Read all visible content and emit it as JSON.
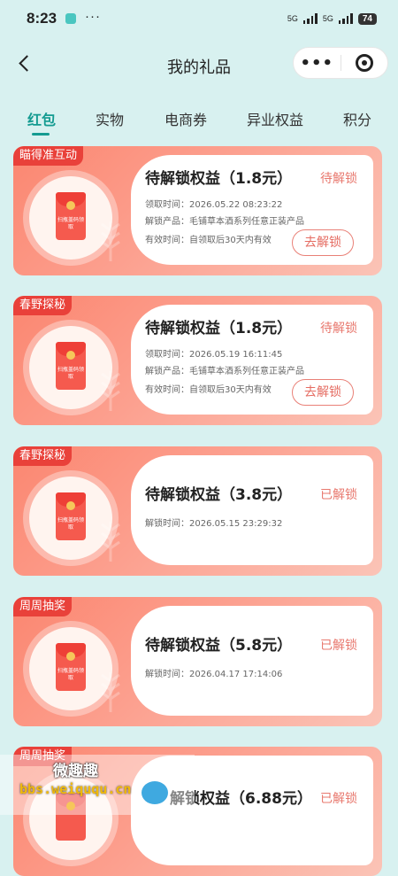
{
  "status_bar": {
    "time": "8:23",
    "net1": "5G",
    "net2": "5G",
    "battery": "74"
  },
  "nav": {
    "title": "我的礼品",
    "more_glyph": "•••"
  },
  "tabs": [
    "红包",
    "实物",
    "电商券",
    "异业权益",
    "积分"
  ],
  "colors": {
    "accent": "#149b91",
    "tag": "#e9413a",
    "status": "#e8786e"
  },
  "cards": [
    {
      "tag": "瞄得准互动",
      "title": "待解锁权益（1.8元）",
      "status": "待解锁",
      "lines": [
        "领取时间：2026.05.22 08:23:22",
        "解锁产品：毛铺草本酒系列任意正装产品",
        "有效时间：自领取后30天内有效"
      ],
      "button": "去解锁",
      "envelope_text": "扫瓶盖码领取"
    },
    {
      "tag": "春野探秘",
      "title": "待解锁权益（1.8元）",
      "status": "待解锁",
      "lines": [
        "领取时间：2026.05.19 16:11:45",
        "解锁产品：毛铺草本酒系列任意正装产品",
        "有效时间：自领取后30天内有效"
      ],
      "button": "去解锁",
      "envelope_text": "扫瓶盖码领取"
    },
    {
      "tag": "春野探秘",
      "title": "待解锁权益（3.8元）",
      "status": "已解锁",
      "lines": [
        "解锁时间：2026.05.15 23:29:32"
      ],
      "envelope_text": "扫瓶盖码领取"
    },
    {
      "tag": "周周抽奖",
      "title": "待解锁权益（5.8元）",
      "status": "已解锁",
      "lines": [
        "解锁时间：2026.04.17 17:14:06"
      ],
      "envelope_text": "扫瓶盖码领取"
    },
    {
      "tag": "周周抽奖",
      "title": "解锁权益（6.88元）",
      "status": "已解锁",
      "lines": [],
      "envelope_text": ""
    }
  ],
  "watermark": {
    "title": "微趣趣",
    "url": "bbs.weiququ.cn"
  }
}
